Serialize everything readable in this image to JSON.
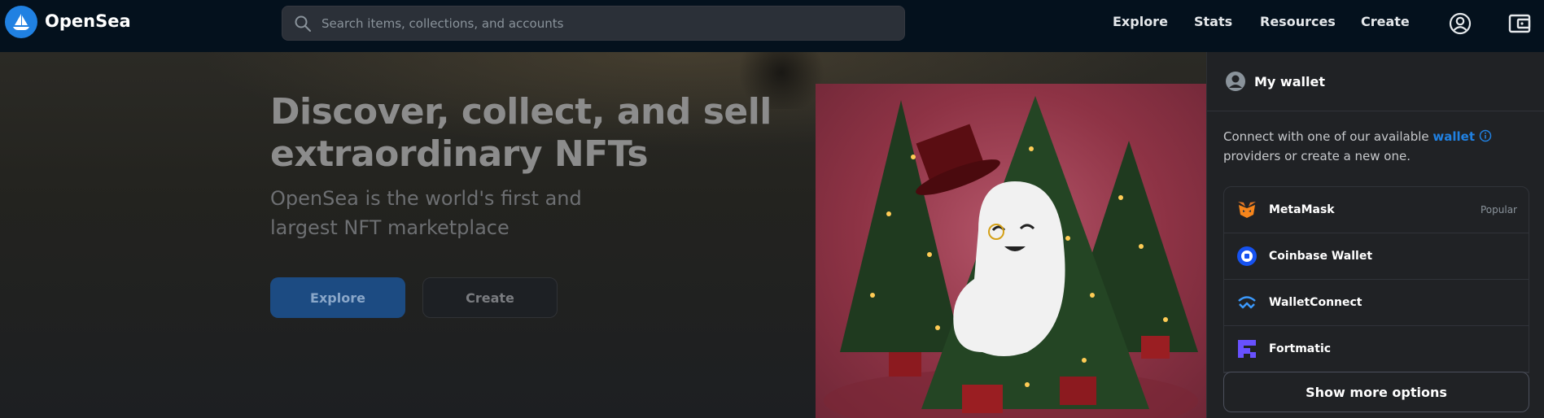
{
  "header": {
    "brand": "OpenSea",
    "search_placeholder": "Search items, collections, and accounts",
    "nav": [
      "Explore",
      "Stats",
      "Resources",
      "Create"
    ]
  },
  "hero": {
    "headline": "Discover, collect, and sell extraordinary NFTs",
    "subhead": "OpenSea is the world's first and largest NFT marketplace",
    "explore_label": "Explore",
    "create_label": "Create"
  },
  "wallet": {
    "title": "My wallet",
    "desc_before": "Connect with one of our available ",
    "desc_link": "wallet",
    "desc_after": " providers or create a new one.",
    "items": [
      {
        "label": "MetaMask",
        "badge": "Popular",
        "icon": "metamask-icon"
      },
      {
        "label": "Coinbase Wallet",
        "badge": "",
        "icon": "coinbase-icon"
      },
      {
        "label": "WalletConnect",
        "badge": "",
        "icon": "walletconnect-icon"
      },
      {
        "label": "Fortmatic",
        "badge": "",
        "icon": "fortmatic-icon"
      }
    ],
    "show_more": "Show more options"
  },
  "colors": {
    "nav_bg": "#04111d",
    "accent": "#2081e2",
    "panel_bg": "#202225"
  }
}
